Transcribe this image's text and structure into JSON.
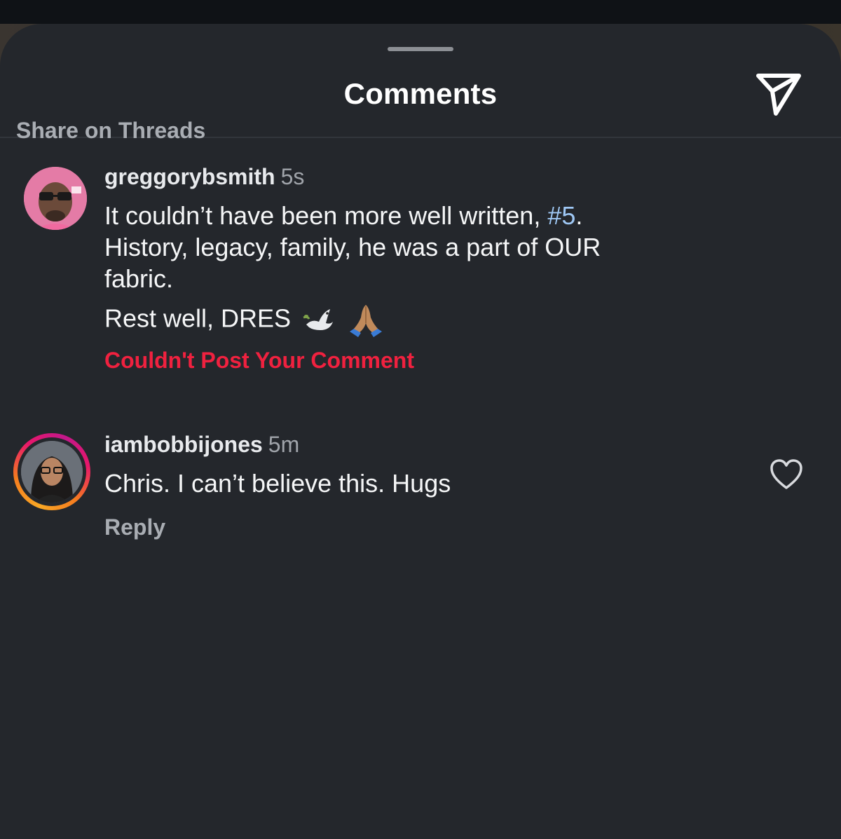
{
  "header": {
    "title": "Comments",
    "send_icon": "paper-plane-icon"
  },
  "share_threads": {
    "label": "Share on Threads"
  },
  "comments": [
    {
      "username": "greggorybsmith",
      "time": "5s",
      "text_line1_before": "It couldn’t have been more well written, ",
      "hashtag": "#5",
      "text_line1_after": ".",
      "text_line2": "History, legacy, family, he was a part of OUR",
      "text_line3": "fabric.",
      "text_line4": "Rest well, DRES",
      "emojis": [
        "dove-emoji",
        "praying-hands-emoji"
      ],
      "error": "Couldn't Post Your Comment",
      "avatar": "avatar-greggorybsmith"
    },
    {
      "username": "iambobbijones",
      "time": "5m",
      "text": "Chris. I can’t believe this. Hugs",
      "reply_label": "Reply",
      "like_icon": "heart-outline-icon",
      "avatar": "avatar-iambobbijones",
      "has_story_ring": true
    }
  ],
  "colors": {
    "sheet_bg": "#24272c",
    "error_red": "#f0213f",
    "hashtag_blue": "#9fc8f5",
    "muted_text": "#a9adb3"
  }
}
